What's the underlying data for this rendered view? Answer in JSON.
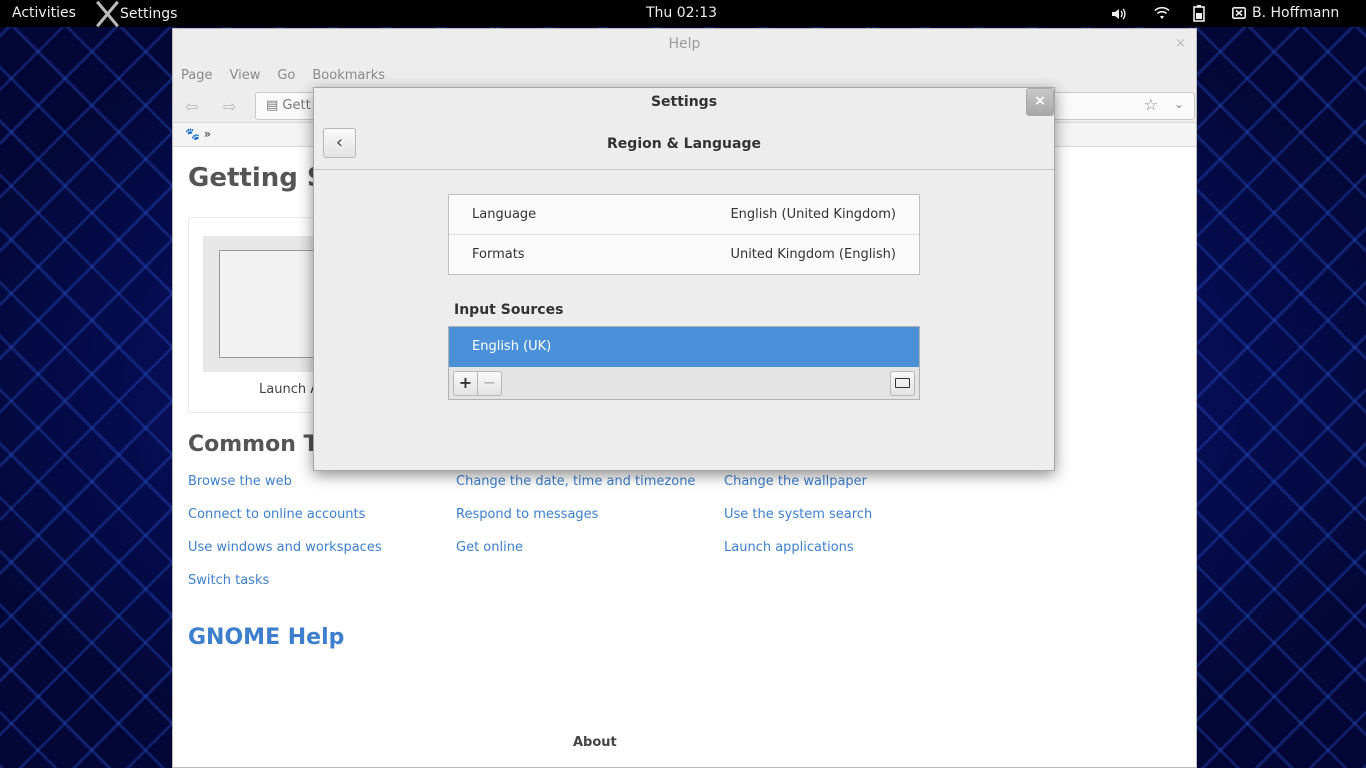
{
  "topbar": {
    "activities": "Activities",
    "app_menu": "Settings",
    "clock": "Thu 02:13",
    "user": "B. Hoffmann",
    "icons": [
      "volume-icon",
      "wifi-icon",
      "battery-icon",
      "user-icon"
    ]
  },
  "help": {
    "title": "Help",
    "close": "×",
    "menu": [
      "Page",
      "View",
      "Go",
      "Bookmarks"
    ],
    "location": "Gett",
    "breadcrumb": "»",
    "getting_started": "Getting S",
    "card_caption": "Launch A",
    "common_tasks": "Common Ta",
    "tasks": {
      "col1": [
        "Browse the web",
        "Connect to online accounts",
        "Use windows and workspaces",
        "Switch tasks"
      ],
      "col2": [
        "Change the date, time and timezone",
        "Respond to messages",
        "Get online"
      ],
      "col3": [
        "Change the wallpaper",
        "Use the system search",
        "Launch applications"
      ]
    },
    "gnome_help": "GNOME Help",
    "about": "About"
  },
  "settings": {
    "title": "Settings",
    "close": "×",
    "page_title": "Region & Language",
    "rows": [
      {
        "label": "Language",
        "value": "English (United Kingdom)"
      },
      {
        "label": "Formats",
        "value": "United Kingdom (English)"
      }
    ],
    "input_sources_label": "Input Sources",
    "input_sources": [
      "English (UK)"
    ],
    "add": "+",
    "remove": "−"
  },
  "colors": {
    "accent": "#4a90d9",
    "link": "#3d7fcd",
    "topbar": "#000000"
  }
}
